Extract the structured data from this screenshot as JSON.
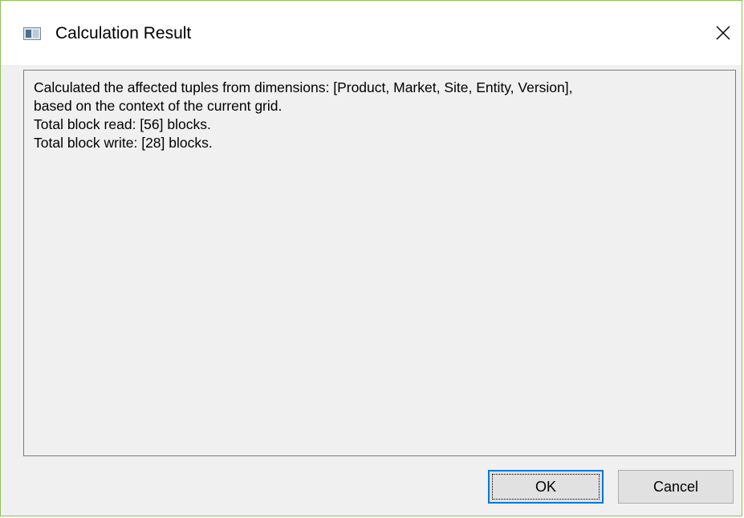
{
  "window": {
    "title": "Calculation Result",
    "icon": "app-window-icon",
    "close_icon": "close-icon"
  },
  "message": {
    "lines": [
      "Calculated the affected tuples from dimensions: [Product, Market, Site, Entity, Version],",
      "based on the context of the current grid.",
      "Total block read: [56] blocks.",
      "Total block write: [28] blocks."
    ]
  },
  "buttons": {
    "ok_label": "OK",
    "cancel_label": "Cancel"
  },
  "colors": {
    "accent": "#0078d7",
    "window_border": "#8fbf5a",
    "dialog_background": "#f0f0f0"
  }
}
